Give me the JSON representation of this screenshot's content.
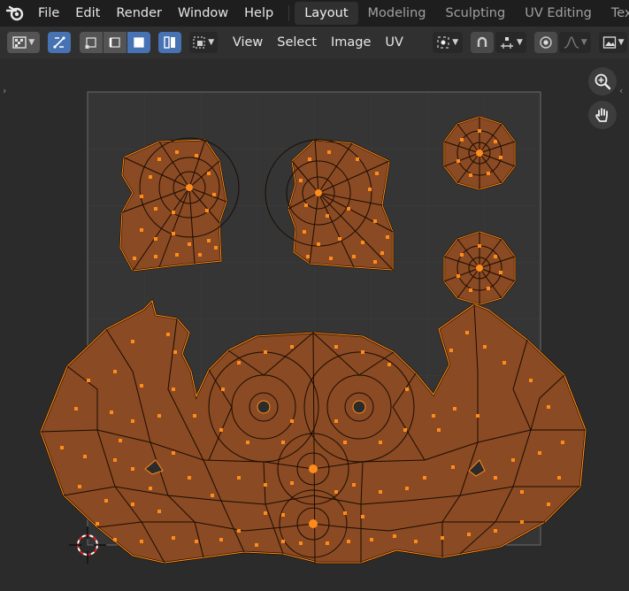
{
  "app": {
    "menu": [
      "File",
      "Edit",
      "Render",
      "Window",
      "Help"
    ],
    "workspaces": [
      {
        "label": "Layout",
        "active": true
      },
      {
        "label": "Modeling",
        "active": false
      },
      {
        "label": "Sculpting",
        "active": false
      },
      {
        "label": "UV Editing",
        "active": false
      },
      {
        "label": "Textu",
        "active": false
      }
    ]
  },
  "header": {
    "menus": [
      "View",
      "Select",
      "Image",
      "UV"
    ],
    "icons": [
      "editor-type-icon",
      "uv-sync-selection-icon",
      "vertex-select-icon",
      "edge-select-icon",
      "face-select-icon",
      "island-select-icon",
      "sticky-select-icon",
      "pivot-icon",
      "snap-icon",
      "snap-target-icon",
      "proportional-icon",
      "falloff-icon",
      "image-browse-icon"
    ]
  },
  "viewport": {
    "nav": [
      "zoom-icon",
      "pan-hand-icon"
    ],
    "colors": {
      "face_fill": "#8a4a24",
      "edge": "#ff8c1a",
      "edge_dark": "#1a0c00",
      "grid": "#3a3a3a",
      "bounds": "#6b6b6b"
    }
  }
}
